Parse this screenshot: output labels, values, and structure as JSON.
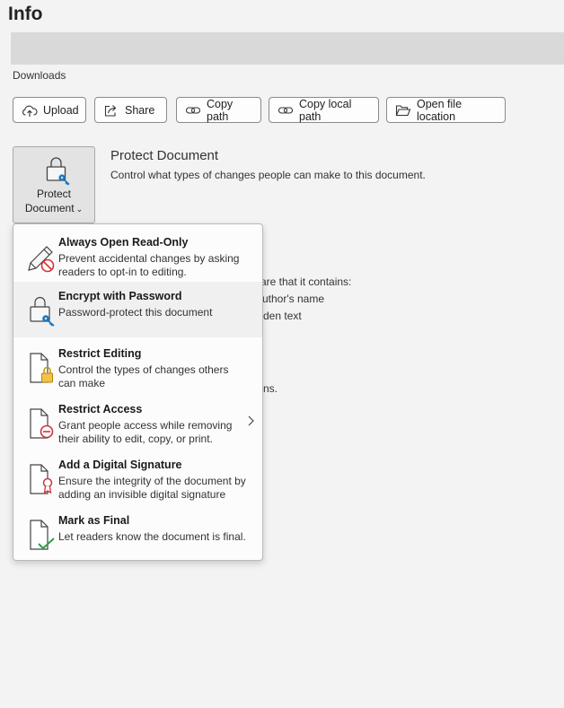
{
  "page": {
    "title": "Info"
  },
  "location": "Downloads",
  "actions": {
    "upload": "Upload",
    "share": "Share",
    "copy_path": "Copy path",
    "copy_local_path": "Copy local path",
    "open_file_location": "Open file location"
  },
  "protect": {
    "button_line1": "Protect",
    "button_line2": "Document",
    "title": "Protect Document",
    "description": "Control what types of changes people can make to this document."
  },
  "background_fragments": {
    "line1": "are that it contains:",
    "line2": "uthor's name",
    "line3": "den text",
    "line4": "ns."
  },
  "menu": {
    "items": [
      {
        "title": "Always Open Read-Only",
        "description": "Prevent accidental changes by asking readers to opt-in to editing.",
        "icon": "pencil-no-icon"
      },
      {
        "title": "Encrypt with Password",
        "description": "Password-protect this document",
        "icon": "lock-key-icon"
      },
      {
        "title": "Restrict Editing",
        "description": "Control the types of changes others can make",
        "icon": "document-lock-icon"
      },
      {
        "title": "Restrict Access",
        "description": "Grant people access while removing their ability to edit, copy, or print.",
        "icon": "document-no-entry-icon"
      },
      {
        "title": "Add a Digital Signature",
        "description": "Ensure the integrity of the document by adding an invisible digital signature",
        "icon": "document-ribbon-icon"
      },
      {
        "title": "Mark as Final",
        "description": "Let readers know the document is final.",
        "icon": "document-check-icon"
      }
    ]
  }
}
